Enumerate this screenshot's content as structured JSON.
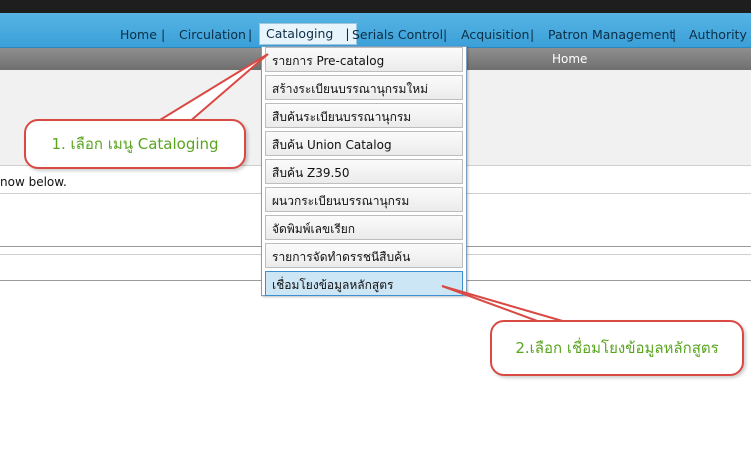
{
  "nav": {
    "items": [
      "Home",
      "Circulation",
      "Cataloging",
      "Serials Control",
      "Acquisition",
      "Patron Management",
      "Authority C"
    ],
    "separator": "|",
    "active_index": 2
  },
  "breadcrumb": {
    "label": "Home"
  },
  "page": {
    "info_text": "now below."
  },
  "dropdown": {
    "items": [
      "รายการ Pre-catalog",
      "สร้างระเบียนบรรณานุกรมใหม่",
      "สืบค้นระเบียนบรรณานุกรม",
      "สืบค้น Union Catalog",
      "สืบค้น Z39.50",
      "ผนวกระเบียนบรรณานุกรม",
      "จัดพิมพ์เลขเรียก",
      "รายการจัดทำดรรชนีสืบค้น",
      "เชื่อมโยงข้อมูลหลักสูตร"
    ],
    "selected_index": 8
  },
  "callouts": {
    "step1": "1. เลือก เมนู Cataloging",
    "step2": "2.เลือก เชื่อมโยงข้อมูลหลักสูตร"
  },
  "colors": {
    "nav": "#3aa0d8",
    "callout_border": "#d94a44",
    "callout_text": "#5aa51f"
  }
}
